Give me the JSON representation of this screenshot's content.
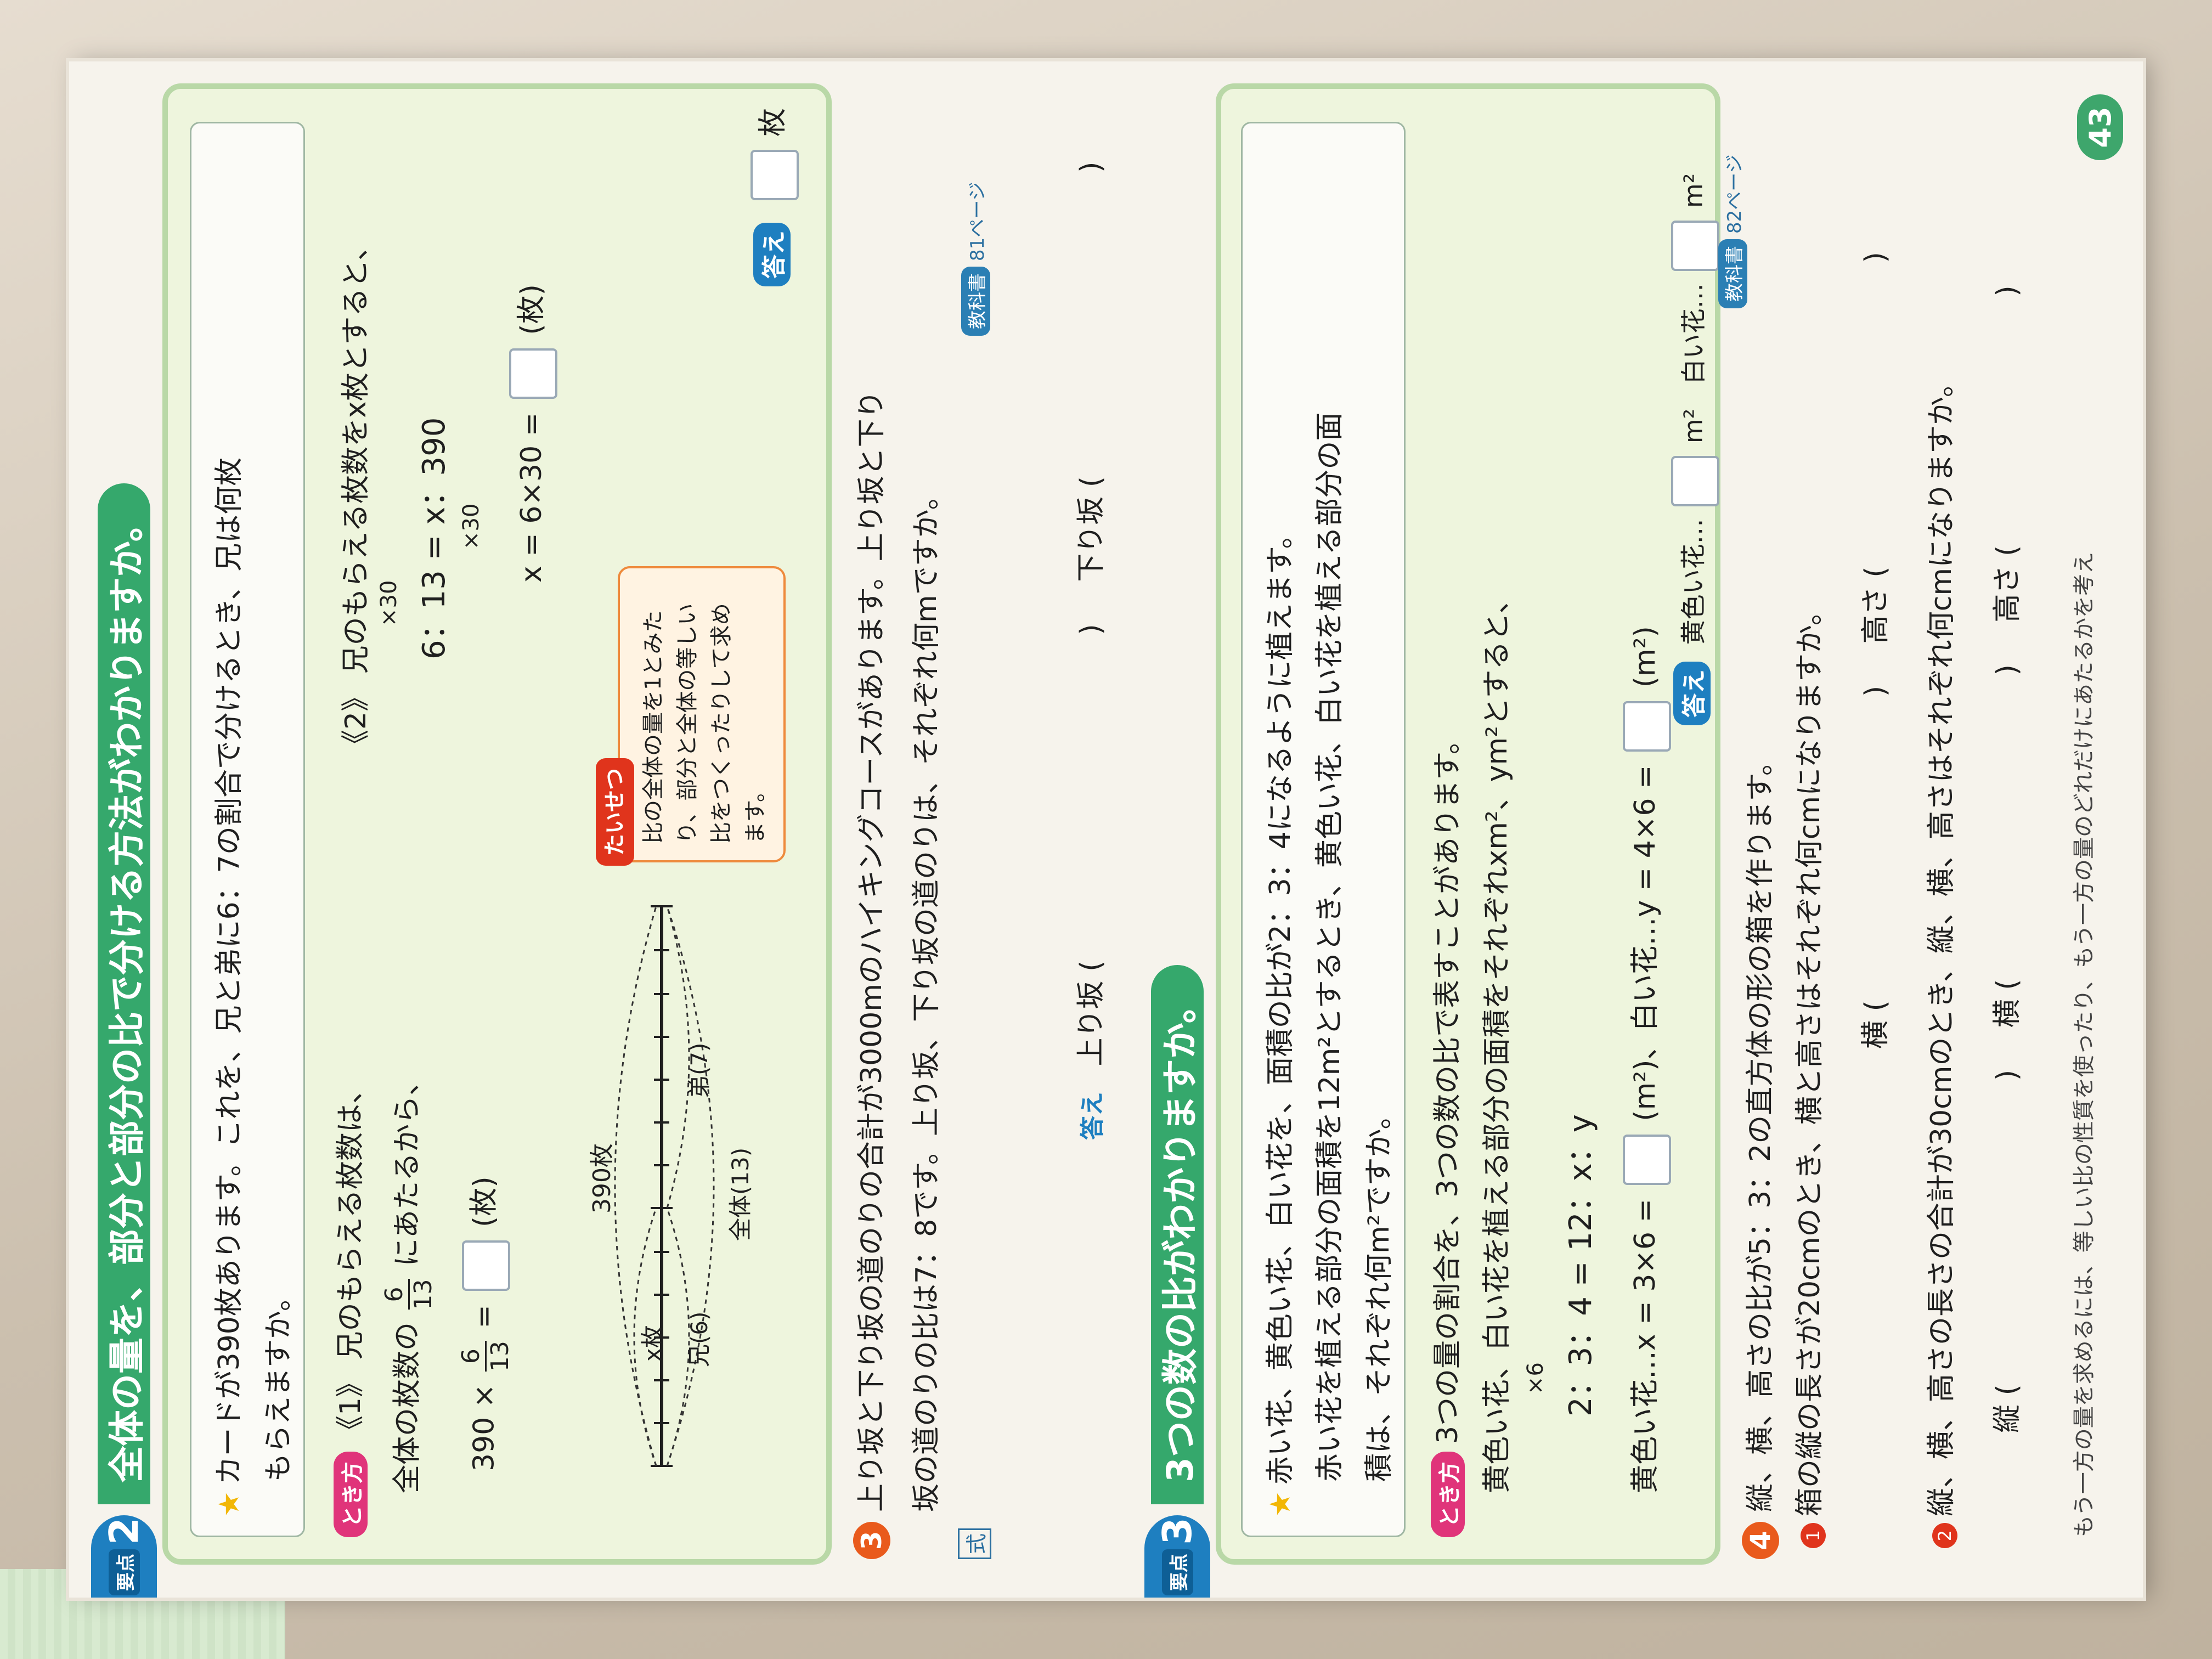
{
  "section2": {
    "kind": "要点",
    "num": "2",
    "title": "全体の量を、部分と部分の比で分ける方法がわかりますか。",
    "problem_line1": "カードが390枚あります。これを、兄と弟に6：7の割合で分けるとき、兄は何枚",
    "problem_line2": "もらえますか。",
    "method_label": "とき方",
    "m1_label": "《1》 兄のもらえる枚数は、",
    "m1_line2_a": "全体の枚数の",
    "m1_frac_num": "6",
    "m1_frac_den": "13",
    "m1_line2_b": "にあたるから、",
    "m1_calc_a": "390 ×",
    "m1_calc_b": "=",
    "m1_unit": "(枚)",
    "m2_label": "《2》 兄のもらえる枚数をx枚とすると、",
    "m2_x30_top": "×30",
    "m2_eq": "6：13 = x：390",
    "m2_x30_bottom": "×30",
    "m2_calc": "x = 6×30 =",
    "m2_unit": "(枚)",
    "diagram_total_top": "390枚",
    "diagram_x": "x枚",
    "diagram_ani": "兄(6)",
    "diagram_otouto": "弟(7)",
    "diagram_total": "全体(13)",
    "note_head": "たいせつ",
    "note_text": "比の全体の量を1とみたり、部分と全体の等しい比をつくったりして求めます。",
    "answer_label": "答え",
    "answer_unit": "枚"
  },
  "q3": {
    "num": "3",
    "line1": "上り坂と下り坂の道のりの合計が3000mのハイキングコースがあります。上り坂と下り",
    "line2": "坂の道のりの比は7：8です。上り坂、下り坂の道のりは、それぞれ何mですか。",
    "shiki": "式",
    "book_label": "教科書",
    "book_ref": "81ページ",
    "answer_label": "答え",
    "uphill": "上り坂",
    "downhill": "下り坂",
    "paren_open": "(",
    "paren_close": ")"
  },
  "section3": {
    "kind": "要点",
    "num": "3",
    "title": "3つの数の比がわかりますか。",
    "line1": "赤い花、黄色い花、白い花を、面積の比が2：3：4になるように植えます。",
    "line2": "赤い花を植える部分の面積を12m²とするとき、黄色い花、白い花を植える部分の面",
    "line3": "積は、それぞれ何m²ですか。",
    "method_label": "とき方",
    "m_line1": "3つの量の割合を、3つの数の比で表すことがあります。",
    "m_line2": "黄色い花、白い花を植える部分の面積をそれぞれxm²、ym²とすると、",
    "x6": "×6",
    "eq": "2：3：4 = 12：x：y",
    "yellow_calc": "黄色い花…x = 3×6 =",
    "white_calc": "(m²)、白い花…y = 4×6 =",
    "unit_m2": "(m²)",
    "answer_label": "答え",
    "ans_yellow": "黄色い花…",
    "ans_white": "白い花…",
    "m2": "m²",
    "book_label": "教科書",
    "book_ref": "82ページ"
  },
  "q4": {
    "num": "4",
    "intro": "縦、横、高さの比が5：3：2の直方体の形の箱を作ります。",
    "p1_num": "1",
    "p1": "箱の縦の長さが20cmのとき、横と高さはそれぞれ何cmになりますか。",
    "p1_yoko": "横",
    "p1_takasa": "高さ",
    "p2_num": "2",
    "p2": "縦、横、高さの長さの合計が30cmのとき、縦、横、高さはそれぞれ何cmになりますか。",
    "p2_tate": "縦",
    "p2_yoko": "横",
    "p2_takasa": "高さ",
    "hint": "もう一方の量を求めるには、等しい比の性質を使ったり、もう一方の量のどれだけにあたるかを考え",
    "paren_open": "(",
    "paren_close": ")"
  },
  "page_number": "43"
}
